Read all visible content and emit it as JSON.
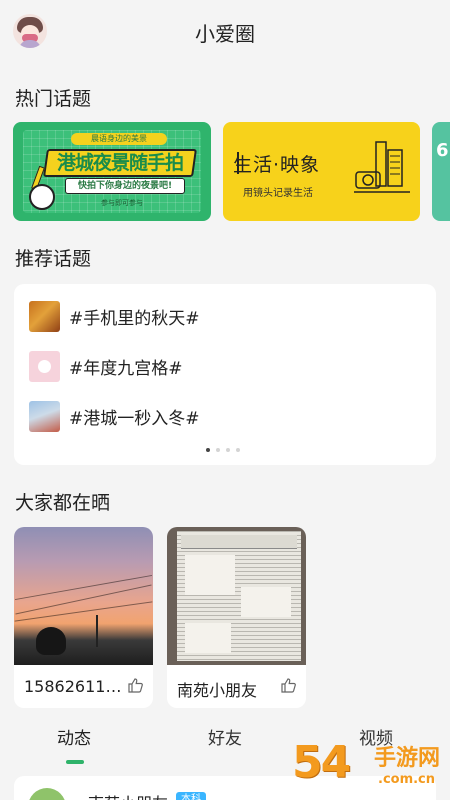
{
  "header": {
    "title": "小爱圈",
    "avatar_icon": "user-avatar-icon"
  },
  "hot_topics": {
    "title": "热门话题",
    "banners": [
      {
        "tag": "晨语身边的美景",
        "headline": "港城夜景随手拍",
        "sub": "快拍下你身边的夜景吧!",
        "foot": "参与即可参与",
        "color": "#2fb46c"
      },
      {
        "headline": "生活·映象",
        "sub": "用镜头记录生活",
        "color": "#f7d21b"
      },
      {
        "headline": "6",
        "color": "#55c3a0"
      }
    ]
  },
  "recommended": {
    "title": "推荐话题",
    "items": [
      {
        "label": "#手机里的秋天#"
      },
      {
        "label": "#年度九宫格#"
      },
      {
        "label": "#港城一秒入冬#"
      }
    ],
    "page_count": 4,
    "current_page": 1
  },
  "everyone_shares": {
    "title": "大家都在晒",
    "posts": [
      {
        "name": "15862611…",
        "like_icon": "thumbs-up-icon"
      },
      {
        "name": "南苑小朋友",
        "like_icon": "thumbs-up-icon"
      }
    ]
  },
  "tabs": [
    {
      "label": "动态",
      "active": true
    },
    {
      "label": "好友",
      "active": false
    },
    {
      "label": "视频",
      "active": false
    }
  ],
  "feed": {
    "first_post": {
      "name": "南苑小朋友",
      "badge": "本科"
    }
  },
  "watermark": {
    "number": "54",
    "text": "手游网",
    "url": ".com.cn"
  }
}
